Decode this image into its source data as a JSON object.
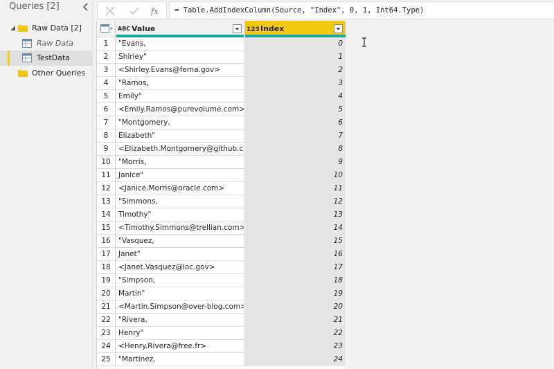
{
  "queries": {
    "title": "Queries [2]",
    "groups": [
      {
        "label": "Raw Data [2]"
      },
      {
        "label": "Other Queries"
      }
    ],
    "items": [
      {
        "label": "Raw Data"
      },
      {
        "label": "TestData"
      }
    ]
  },
  "formula": {
    "text": "= Table.AddIndexColumn(Source, \"Index\", 0, 1, Int64.Type)"
  },
  "table": {
    "columns": [
      {
        "type_glyph": "ABC",
        "name": "Value"
      },
      {
        "type_glyph": "123",
        "name": "Index"
      }
    ],
    "rows": [
      {
        "n": "1",
        "value": "\"Evans,",
        "index": "0"
      },
      {
        "n": "2",
        "value": "Shirley\"",
        "index": "1"
      },
      {
        "n": "3",
        "value": "<Shirley.Evans@fema.gov>",
        "index": "2"
      },
      {
        "n": "4",
        "value": "\"Ramos,",
        "index": "3"
      },
      {
        "n": "5",
        "value": "Emily\"",
        "index": "4"
      },
      {
        "n": "6",
        "value": "<Emily.Ramos@purevolume.com>",
        "index": "5"
      },
      {
        "n": "7",
        "value": "\"Montgomery,",
        "index": "6"
      },
      {
        "n": "8",
        "value": "Elizabeth\"",
        "index": "7"
      },
      {
        "n": "9",
        "value": "<Elizabeth.Montgomery@github.com>",
        "index": "8"
      },
      {
        "n": "10",
        "value": "\"Morris,",
        "index": "9"
      },
      {
        "n": "11",
        "value": "Janice\"",
        "index": "10"
      },
      {
        "n": "12",
        "value": "<Janice.Morris@oracle.com>",
        "index": "11"
      },
      {
        "n": "13",
        "value": "\"Simmons,",
        "index": "12"
      },
      {
        "n": "14",
        "value": "Timothy\"",
        "index": "13"
      },
      {
        "n": "15",
        "value": "<Timothy.Simmons@trellian.com>",
        "index": "14"
      },
      {
        "n": "16",
        "value": "\"Vasquez,",
        "index": "15"
      },
      {
        "n": "17",
        "value": "Janet\"",
        "index": "16"
      },
      {
        "n": "18",
        "value": "<Janet.Vasquez@loc.gov>",
        "index": "17"
      },
      {
        "n": "19",
        "value": "\"Simpson,",
        "index": "18"
      },
      {
        "n": "20",
        "value": "Martin\"",
        "index": "19"
      },
      {
        "n": "21",
        "value": "<Martin.Simpson@over-blog.com>",
        "index": "20"
      },
      {
        "n": "22",
        "value": "\"Rivera,",
        "index": "21"
      },
      {
        "n": "23",
        "value": "Henry\"",
        "index": "22"
      },
      {
        "n": "24",
        "value": "<Henry.Rivera@free.fr>",
        "index": "23"
      },
      {
        "n": "25",
        "value": "\"Martinez,",
        "index": "24"
      }
    ]
  },
  "colors": {
    "accent": "#f2c811",
    "quality_bar": "#1aa5a5",
    "selected_bg": "#e1dfdd"
  },
  "icons": [
    "chevron-left-icon",
    "expand-triangle-icon",
    "folder-icon",
    "table-icon",
    "cancel-x-icon",
    "check-icon",
    "fx-icon",
    "column-type-icon",
    "dropdown-arrow-icon",
    "text-cursor-icon"
  ]
}
